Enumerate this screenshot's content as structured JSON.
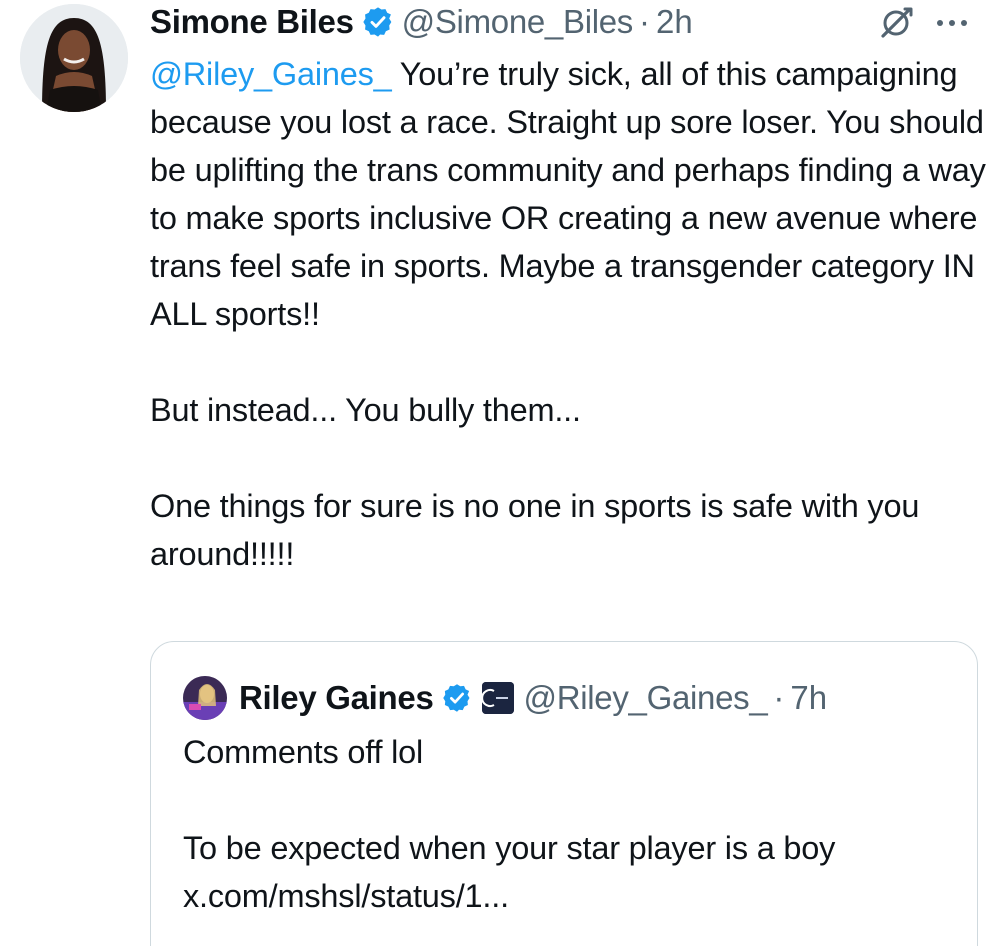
{
  "tweet": {
    "author_name": "Simone Biles",
    "author_handle": "@Simone_Biles",
    "separator": "·",
    "time": "2h",
    "mention": "@Riley_Gaines_",
    "paragraphs": [
      " You’re truly sick, all of this campaigning because you lost a race. Straight up sore loser. You should be uplifting the trans community and perhaps finding a way to make sports inclusive OR creating a new avenue where trans feel safe in sports. Maybe a transgender category IN ALL sports!!",
      "But instead... You bully them...",
      "One things for sure is no one in sports is safe with you around!!!!!"
    ],
    "icons": {
      "verified": "verified-badge-icon",
      "grok": "grok-icon",
      "more": "more-options-icon",
      "avatar": "avatar"
    }
  },
  "quoted_tweet": {
    "author_name": "Riley Gaines",
    "author_handle": "@Riley_Gaines_",
    "separator": "·",
    "time": "7h",
    "lines": [
      "Comments off lol",
      "To be expected when your star player is a boy",
      "x.com/mshsl/status/1..."
    ],
    "icons": {
      "verified": "verified-badge-icon",
      "affiliation": "affiliation-badge-icon"
    }
  },
  "colors": {
    "text": "#0f1419",
    "secondary": "#536471",
    "link": "#1d9bf0",
    "verified": "#1d9bf0",
    "border": "#cfd9de"
  }
}
